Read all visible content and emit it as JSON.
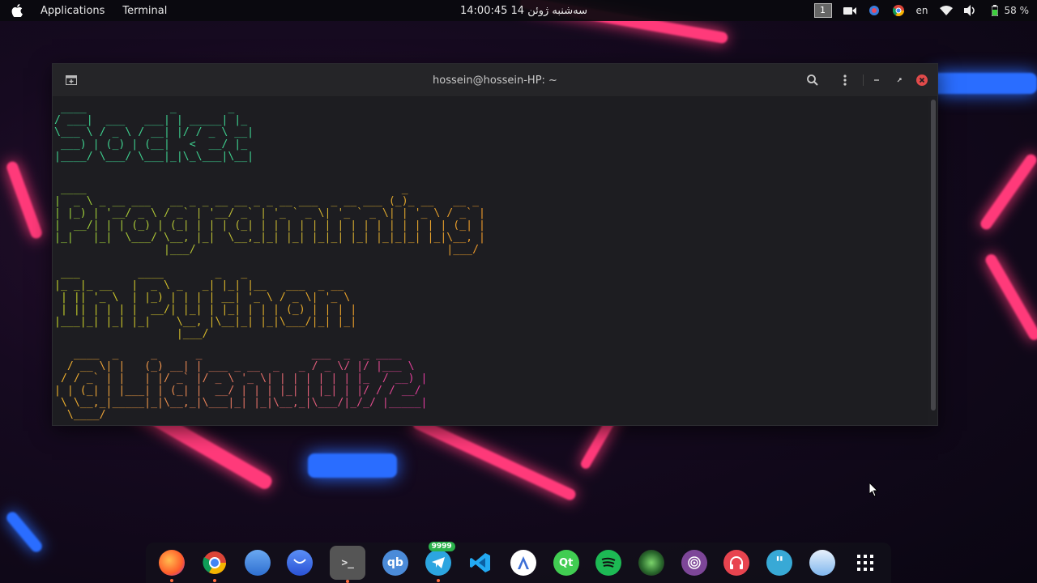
{
  "topbar": {
    "menu": [
      "Applications",
      "Terminal"
    ],
    "clock": "14:00:45  14 سه‌شنبه ژوئن",
    "workspace": "1",
    "lang": "en",
    "battery": "58 %"
  },
  "terminal": {
    "title": "hossein@hossein-HP: ~",
    "art": {
      "socket": " ____             _        _\n/ ___|  ___   ___| | _____| |_\n\\___ \\ / _ \\ / __| |/ / _ \\ __|\n ___) | (_) | (__|   <  __/ |_\n|____/ \\___/ \\___|_|\\_\\___|\\__|",
      "programming": " ____                                                 _\n|  _ \\ _ __ ___   __ _ _ __ __ _ _ __ ___  _ __ ___ (_)_ __   __ _\n| |_) | '__/ _ \\ / _` | '__/ _` | '_ ` _ \\| '_ ` _ \\| | '_ \\ / _` |\n|  __/| | | (_) | (_| | | | (_| | | | | | | | | | | | | | | | (_| |\n|_|   |_|  \\___/ \\__, |_|  \\__,_|_| |_| |_|_| |_| |_|_|_| |_|\\__, |\n                 |___/                                       |___/",
      "inpython": " ___         ____        _   _\n|_ _|_ __   |  _ \\ _   _| |_| |__   ___  _ __\n | || '_ \\  | |_) | | | | __| '_ \\ / _ \\| '_ \\\n | || | | | |  __/| |_| | |_| | | | (_) | | | |\n|___|_| |_| |_|    \\__, |\\__|_| |_|\\___/|_| |_|\n                   |___/",
      "handle": "   ____  _     _      _                 ___  _  _ ____\n  / __ \\| |   (_) __| | ___ _ __  _   _ / _ \\/ |/ |___ \\\n / / _` | |   | |/ _` |/ _ \\ '_ \\| | | | | | | |_  / __) |\n| | (_| | |___| | (_| |  __/ | | | |_| | |_| | |/ / / __/\n \\ \\__,_|_____|_|\\__,_|\\___|_| |_|\\__,_|\\___/|_/_/ |_____|\n  \\____/"
    }
  },
  "dock": {
    "telegram_badge": "9999",
    "apps": [
      "firefox-icon",
      "chrome-icon",
      "files-icon",
      "mail-icon",
      "terminal-icon",
      "qbittorrent-icon",
      "telegram-icon",
      "vscode-icon",
      "android-studio-icon",
      "qt-creator-icon",
      "spotify-icon",
      "browser-icon",
      "tor-icon",
      "podcast-icon",
      "quotes-icon",
      "notes-icon",
      "app-grid-icon"
    ]
  },
  "colors": {
    "socket": "#3ecf8e",
    "programming_from": "#9ad43a",
    "programming_to": "#f29b2a",
    "handle_from": "#f2b52a",
    "handle_to": "#e03aa0"
  }
}
